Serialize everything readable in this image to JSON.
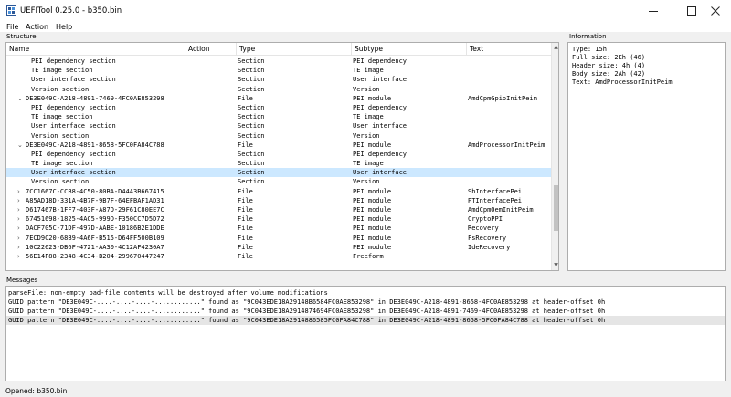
{
  "window": {
    "title": "UEFITool 0.25.0 - b350.bin",
    "icon": "uefitool-app-icon",
    "controls": [
      "minimize-icon",
      "maximize-icon",
      "close-icon"
    ]
  },
  "menu": [
    "File",
    "Action",
    "Help"
  ],
  "structure": {
    "label": "Structure",
    "columns": [
      "Name",
      "Action",
      "Type",
      "Subtype",
      "Text"
    ],
    "rows": [
      {
        "level": 2,
        "name": "PEI dependency section",
        "type": "Section",
        "subtype": "PEI dependency",
        "text": ""
      },
      {
        "level": 2,
        "name": "TE image section",
        "type": "Section",
        "subtype": "TE image",
        "text": ""
      },
      {
        "level": 2,
        "name": "User interface section",
        "type": "Section",
        "subtype": "User interface",
        "text": ""
      },
      {
        "level": 2,
        "name": "Version section",
        "type": "Section",
        "subtype": "Version",
        "text": ""
      },
      {
        "level": 1,
        "expander": "expanded",
        "name": "DE3E049C-A218-4891-7469-4FC0AE853298",
        "type": "File",
        "subtype": "PEI module",
        "text": "AmdCpmGpioInitPeim"
      },
      {
        "level": 2,
        "name": "PEI dependency section",
        "type": "Section",
        "subtype": "PEI dependency",
        "text": ""
      },
      {
        "level": 2,
        "name": "TE image section",
        "type": "Section",
        "subtype": "TE image",
        "text": ""
      },
      {
        "level": 2,
        "name": "User interface section",
        "type": "Section",
        "subtype": "User interface",
        "text": ""
      },
      {
        "level": 2,
        "name": "Version section",
        "type": "Section",
        "subtype": "Version",
        "text": ""
      },
      {
        "level": 1,
        "expander": "expanded",
        "name": "DE3E049C-A218-4891-8658-5FC0FA84C788",
        "type": "File",
        "subtype": "PEI module",
        "text": "AmdProcessorInitPeim"
      },
      {
        "level": 2,
        "name": "PEI dependency section",
        "type": "Section",
        "subtype": "PEI dependency",
        "text": ""
      },
      {
        "level": 2,
        "name": "TE image section",
        "type": "Section",
        "subtype": "TE image",
        "text": ""
      },
      {
        "level": 2,
        "name": "User interface section",
        "type": "Section",
        "subtype": "User interface",
        "text": "",
        "selected": true
      },
      {
        "level": 2,
        "name": "Version section",
        "type": "Section",
        "subtype": "Version",
        "text": ""
      },
      {
        "level": 1,
        "expander": "collapsed",
        "name": "7CC1667C-CCB8-4C50-80BA-D44A3B667415",
        "type": "File",
        "subtype": "PEI module",
        "text": "SbInterfacePei"
      },
      {
        "level": 1,
        "expander": "collapsed",
        "name": "A85AD18D-331A-4B7F-9B7F-64EFBAF1AD31",
        "type": "File",
        "subtype": "PEI module",
        "text": "PTInterfacePei"
      },
      {
        "level": 1,
        "expander": "collapsed",
        "name": "D617467B-1FF7-403F-A87D-29F61C80EE7C",
        "type": "File",
        "subtype": "PEI module",
        "text": "AmdCpmOemInitPeim"
      },
      {
        "level": 1,
        "expander": "collapsed",
        "name": "67451698-1825-4AC5-999D-F350CC7D5D72",
        "type": "File",
        "subtype": "PEI module",
        "text": "CryptoPPI"
      },
      {
        "level": 1,
        "expander": "collapsed",
        "name": "DACF705C-71DF-497D-AABE-10186B2E1DDE",
        "type": "File",
        "subtype": "PEI module",
        "text": "Recovery"
      },
      {
        "level": 1,
        "expander": "collapsed",
        "name": "7ECD9C20-68B9-4A6F-B515-D64FF500B109",
        "type": "File",
        "subtype": "PEI module",
        "text": "FsRecovery"
      },
      {
        "level": 1,
        "expander": "collapsed",
        "name": "10C22623-DB6F-4721-AA30-4C12AF4230A7",
        "type": "File",
        "subtype": "PEI module",
        "text": "IdeRecovery"
      },
      {
        "level": 1,
        "expander": "collapsed",
        "name": "56E14F88-2348-4C34-B204-299670447247",
        "type": "File",
        "subtype": "Freeform",
        "text": ""
      }
    ]
  },
  "information": {
    "label": "Information",
    "lines": [
      "Type: 15h",
      "Full size: 2Eh (46)",
      "Header size: 4h (4)",
      "Body size: 2Ah (42)",
      "Text: AmdProcessorInitPeim"
    ]
  },
  "messages": {
    "label": "Messages",
    "lines": [
      {
        "text": "parseFile: non-empty pad-file contents will be destroyed after volume modifications"
      },
      {
        "text": "GUID pattern \"DE3E049C-....-....-....-............\" found as \"9C043EDE18A29148B6584FC0AE853298\" in DE3E049C-A218-4891-8658-4FC0AE853298 at header-offset 0h"
      },
      {
        "text": "GUID pattern \"DE3E049C-....-....-....-............\" found as \"9C043EDE18A2914874694FC0AE853298\" in DE3E049C-A218-4891-7469-4FC0AE853298 at header-offset 0h"
      },
      {
        "text": "GUID pattern \"DE3E049C-....-....-....-............\" found as \"9C043EDE18A2914886585FC0FA84C788\" in DE3E049C-A218-4891-8658-5FC0FA84C788 at header-offset 0h",
        "selected": true
      }
    ]
  },
  "status": {
    "text": "Opened: b350.bin"
  }
}
